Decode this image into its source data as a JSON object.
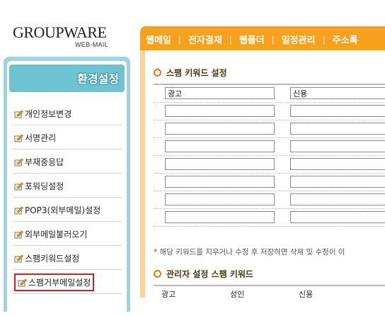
{
  "logo": {
    "main": "GROUPWARE",
    "sub": "WEB-MAIL"
  },
  "sidebar": {
    "title": "환경설정",
    "items": [
      {
        "label": "개인정보변경",
        "icon": "pencil-note-icon"
      },
      {
        "label": "서명관리",
        "icon": "pencil-note-icon"
      },
      {
        "label": "부재중응답",
        "icon": "pencil-note-icon"
      },
      {
        "label": "포워딩설정",
        "icon": "pencil-note-icon"
      },
      {
        "label": "POP3(외부메일)설정",
        "icon": "pencil-note-icon"
      },
      {
        "label": "외부메일불러오기",
        "icon": "pencil-note-icon"
      },
      {
        "label": "스팸키워드설정",
        "icon": "pencil-note-icon"
      },
      {
        "label": "스팸거부메일설정",
        "icon": "pencil-note-icon",
        "selected": true
      }
    ]
  },
  "nav": {
    "items": [
      "웹메일",
      "전자결재",
      "웹폴더",
      "일정관리",
      "주소록"
    ],
    "separator": "|"
  },
  "spam_keywords": {
    "title": "스팸 키워드 설정",
    "rows": [
      [
        "광고",
        "신용"
      ],
      [
        "",
        ""
      ],
      [
        "",
        ""
      ],
      [
        "",
        ""
      ],
      [
        "",
        ""
      ],
      [
        "",
        ""
      ],
      [
        "",
        ""
      ],
      [
        "",
        ""
      ]
    ],
    "note_star": "*",
    "note": "해당 키워드를 지우거나 수정 후 저장하면 삭제 및 수정이 이"
  },
  "admin_keywords": {
    "title": "관리자 설정 스팸 키워드",
    "headers": [
      "광고",
      "성인",
      "신용"
    ]
  },
  "colors": {
    "nav": "#f7a11e",
    "sidebar": "#9fd3de",
    "sidebar_header": "#6ec3d3",
    "accent": "#e07a10",
    "selected_outline": "#d42020"
  }
}
